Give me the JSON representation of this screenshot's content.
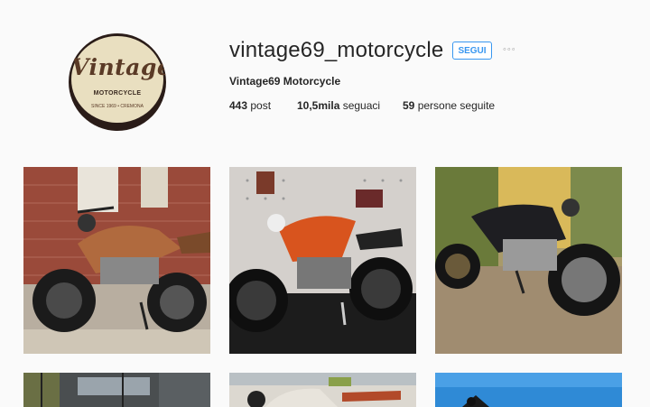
{
  "profile": {
    "username": "vintage69_motorcycle",
    "full_name": "Vintage69 Motorcycle",
    "follow_label": "SEGUI",
    "more_label": "◦◦◦",
    "avatar": {
      "brand": "Vintage",
      "subtitle": "MOTORCYCLE",
      "ring_text": "SINCE 1969 • CREMONA"
    },
    "stats": {
      "posts_count": "443",
      "posts_label": " post",
      "followers_count": "10,5mila",
      "followers_label": " seguaci",
      "following_count": "59",
      "following_label": " persone seguite"
    }
  },
  "grid": {
    "posts": [
      {
        "name": "post-brown-scrambler",
        "alt": "brown cafe racer against brick wall"
      },
      {
        "name": "post-orange-racer",
        "alt": "orange cafe racer in garage"
      },
      {
        "name": "post-black-scrambler",
        "alt": "black scrambler outdoors"
      },
      {
        "name": "post-row2-1",
        "alt": "motorcycles in workshop"
      },
      {
        "name": "post-row2-2",
        "alt": "white tank motorcycle"
      },
      {
        "name": "post-row2-3",
        "alt": "motorcycle under blue sky"
      }
    ]
  },
  "colors": {
    "accent": "#3897f0",
    "background": "#fafafa",
    "text": "#262626"
  }
}
